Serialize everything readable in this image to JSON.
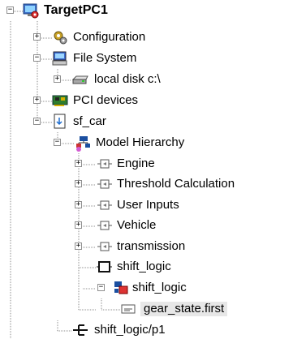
{
  "tree": {
    "nodes": [
      {
        "label": "TargetPC1",
        "expander": "−",
        "icon": "target-pc-icon"
      },
      {
        "label": "Configuration",
        "expander": "+",
        "icon": "configuration-gear-icon"
      },
      {
        "label": "File System",
        "expander": "−",
        "icon": "computer-icon"
      },
      {
        "label": "local disk c:\\",
        "expander": "+",
        "icon": "disk-drive-icon"
      },
      {
        "label": "PCI devices",
        "expander": "+",
        "icon": "pci-card-icon"
      },
      {
        "label": "sf_car",
        "expander": "−",
        "icon": "model-file-icon"
      },
      {
        "label": "Model Hierarchy",
        "expander": "−",
        "icon": "hierarchy-icon"
      },
      {
        "label": "Engine",
        "expander": "+",
        "icon": "subsystem-icon"
      },
      {
        "label": "Threshold Calculation",
        "expander": "+",
        "icon": "subsystem-icon"
      },
      {
        "label": "User Inputs",
        "expander": "+",
        "icon": "subsystem-icon"
      },
      {
        "label": "Vehicle",
        "expander": "+",
        "icon": "subsystem-icon"
      },
      {
        "label": "transmission",
        "expander": "+",
        "icon": "subsystem-icon"
      },
      {
        "label": "shift_logic",
        "expander": "",
        "icon": "block-icon"
      },
      {
        "label": "shift_logic",
        "expander": "−",
        "icon": "stateflow-chart-icon"
      },
      {
        "label": "gear_state.first",
        "expander": "",
        "icon": "signal-icon"
      },
      {
        "label": "shift_logic/p1",
        "expander": "",
        "icon": "parameter-icon"
      }
    ]
  },
  "colors": {
    "selection": "#e7e7e7",
    "connector": "#8f8f8f",
    "expander_border": "#8f8f8f"
  }
}
